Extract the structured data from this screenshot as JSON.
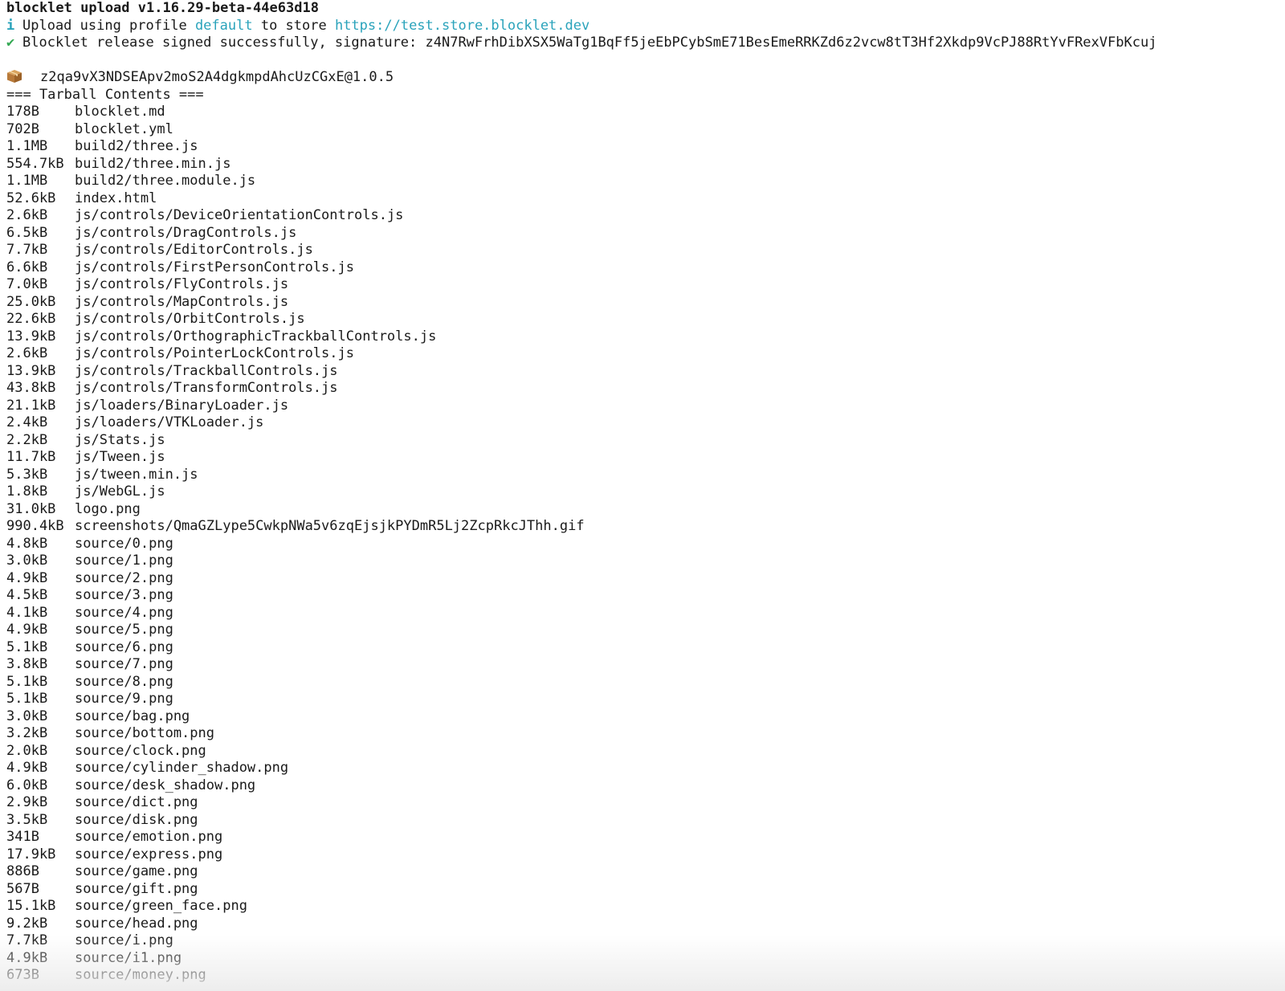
{
  "header": {
    "command": "blocklet upload v1.16.29-beta-44e63d18",
    "info_icon": "i",
    "upload_prefix": "Upload using profile ",
    "profile": "default",
    "upload_mid": " to store ",
    "store_url": "https://test.store.blocklet.dev",
    "check_icon": "✔",
    "signed_text": "Blocklet release signed successfully, signature: z4N7RwFrhDibXSX5WaTg1BqFf5jeEbPCybSmE71BesEmeRRKZd6z2vcw8tT3Hf2Xkdp9VcPJ88RtYvFRexVFbKcuj"
  },
  "package": {
    "icon": "package-icon",
    "name": "z2qa9vX3NDSEApv2moS2A4dgkmpdAhcUzCGxE@1.0.5"
  },
  "tarball_title": "=== Tarball Contents ===",
  "files": [
    {
      "size": "178B",
      "path": "blocklet.md"
    },
    {
      "size": "702B",
      "path": "blocklet.yml"
    },
    {
      "size": "1.1MB",
      "path": "build2/three.js"
    },
    {
      "size": "554.7kB",
      "path": "build2/three.min.js"
    },
    {
      "size": "1.1MB",
      "path": "build2/three.module.js"
    },
    {
      "size": "52.6kB",
      "path": "index.html"
    },
    {
      "size": "2.6kB",
      "path": "js/controls/DeviceOrientationControls.js"
    },
    {
      "size": "6.5kB",
      "path": "js/controls/DragControls.js"
    },
    {
      "size": "7.7kB",
      "path": "js/controls/EditorControls.js"
    },
    {
      "size": "6.6kB",
      "path": "js/controls/FirstPersonControls.js"
    },
    {
      "size": "7.0kB",
      "path": "js/controls/FlyControls.js"
    },
    {
      "size": "25.0kB",
      "path": "js/controls/MapControls.js"
    },
    {
      "size": "22.6kB",
      "path": "js/controls/OrbitControls.js"
    },
    {
      "size": "13.9kB",
      "path": "js/controls/OrthographicTrackballControls.js"
    },
    {
      "size": "2.6kB",
      "path": "js/controls/PointerLockControls.js"
    },
    {
      "size": "13.9kB",
      "path": "js/controls/TrackballControls.js"
    },
    {
      "size": "43.8kB",
      "path": "js/controls/TransformControls.js"
    },
    {
      "size": "21.1kB",
      "path": "js/loaders/BinaryLoader.js"
    },
    {
      "size": "2.4kB",
      "path": "js/loaders/VTKLoader.js"
    },
    {
      "size": "2.2kB",
      "path": "js/Stats.js"
    },
    {
      "size": "11.7kB",
      "path": "js/Tween.js"
    },
    {
      "size": "5.3kB",
      "path": "js/tween.min.js"
    },
    {
      "size": "1.8kB",
      "path": "js/WebGL.js"
    },
    {
      "size": "31.0kB",
      "path": "logo.png"
    },
    {
      "size": "990.4kB",
      "path": "screenshots/QmaGZLype5CwkpNWa5v6zqEjsjkPYDmR5Lj2ZcpRkcJThh.gif"
    },
    {
      "size": "4.8kB",
      "path": "source/0.png"
    },
    {
      "size": "3.0kB",
      "path": "source/1.png"
    },
    {
      "size": "4.9kB",
      "path": "source/2.png"
    },
    {
      "size": "4.5kB",
      "path": "source/3.png"
    },
    {
      "size": "4.1kB",
      "path": "source/4.png"
    },
    {
      "size": "4.9kB",
      "path": "source/5.png"
    },
    {
      "size": "5.1kB",
      "path": "source/6.png"
    },
    {
      "size": "3.8kB",
      "path": "source/7.png"
    },
    {
      "size": "5.1kB",
      "path": "source/8.png"
    },
    {
      "size": "5.1kB",
      "path": "source/9.png"
    },
    {
      "size": "3.0kB",
      "path": "source/bag.png"
    },
    {
      "size": "3.2kB",
      "path": "source/bottom.png"
    },
    {
      "size": "2.0kB",
      "path": "source/clock.png"
    },
    {
      "size": "4.9kB",
      "path": "source/cylinder_shadow.png"
    },
    {
      "size": "6.0kB",
      "path": "source/desk_shadow.png"
    },
    {
      "size": "2.9kB",
      "path": "source/dict.png"
    },
    {
      "size": "3.5kB",
      "path": "source/disk.png"
    },
    {
      "size": "341B",
      "path": "source/emotion.png"
    },
    {
      "size": "17.9kB",
      "path": "source/express.png"
    },
    {
      "size": "886B",
      "path": "source/game.png"
    },
    {
      "size": "567B",
      "path": "source/gift.png"
    },
    {
      "size": "15.1kB",
      "path": "source/green_face.png"
    },
    {
      "size": "9.2kB",
      "path": "source/head.png"
    },
    {
      "size": "7.7kB",
      "path": "source/i.png"
    },
    {
      "size": "4.9kB",
      "path": "source/i1.png"
    },
    {
      "size": "673B",
      "path": "source/money.png"
    }
  ]
}
